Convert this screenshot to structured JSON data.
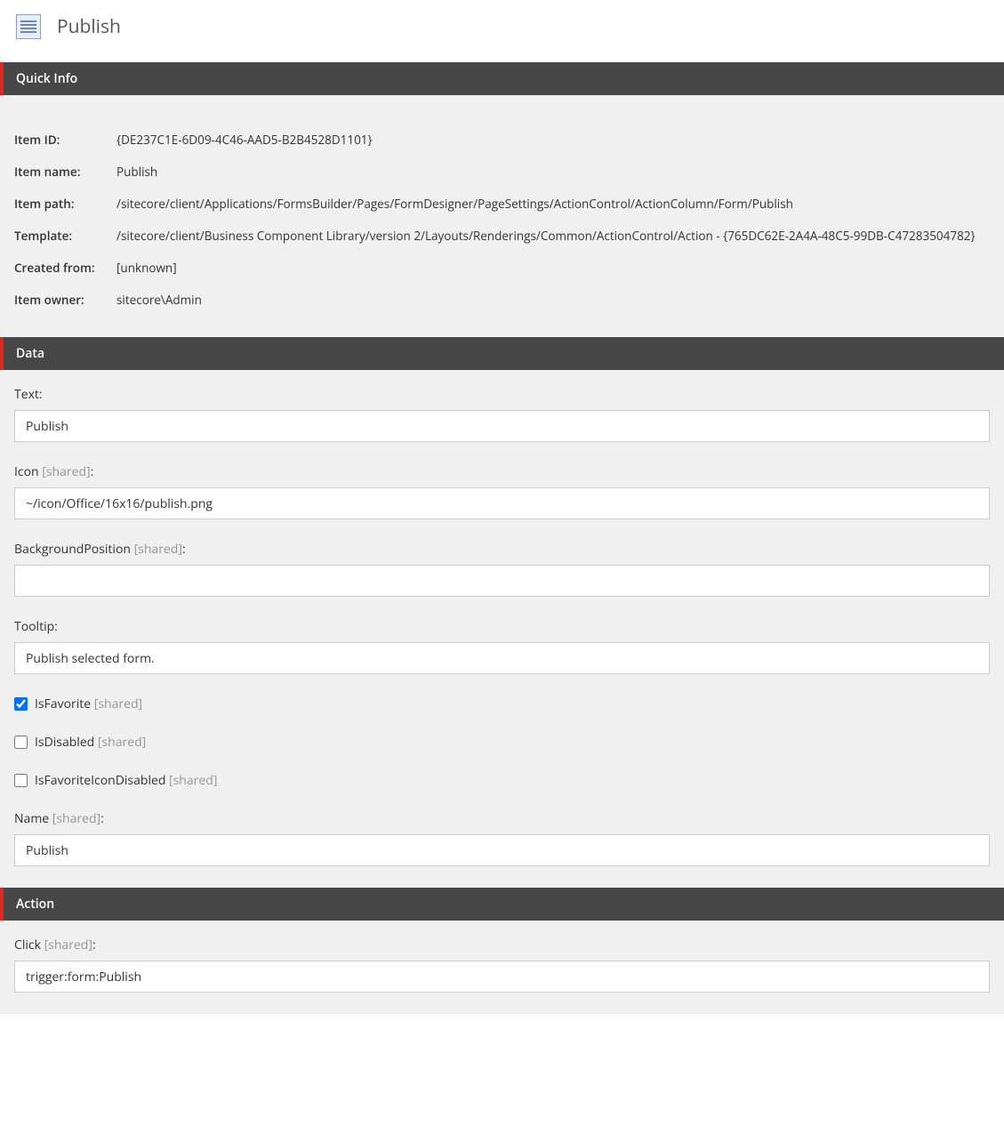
{
  "header": {
    "title": "Publish"
  },
  "sections": {
    "quick_info": {
      "title": "Quick Info",
      "rows": {
        "item_id": {
          "label": "Item ID:",
          "value": "{DE237C1E-6D09-4C46-AAD5-B2B4528D1101}"
        },
        "item_name": {
          "label": "Item name:",
          "value": "Publish"
        },
        "item_path": {
          "label": "Item path:",
          "value": "/sitecore/client/Applications/FormsBuilder/Pages/FormDesigner/PageSettings/ActionControl/ActionColumn/Form/Publish"
        },
        "template": {
          "label": "Template:",
          "value": "/sitecore/client/Business Component Library/version 2/Layouts/Renderings/Common/ActionControl/Action - {765DC62E-2A4A-48C5-99DB-C47283504782}"
        },
        "created_from": {
          "label": "Created from:",
          "value": "[unknown]"
        },
        "item_owner": {
          "label": "Item owner:",
          "value": "sitecore\\Admin"
        }
      }
    },
    "data": {
      "title": "Data",
      "fields": {
        "text": {
          "label": "Text:",
          "shared": "",
          "value": "Publish"
        },
        "icon": {
          "label": "Icon ",
          "shared": "[shared]",
          "suffix": ":",
          "value": "~/icon/Office/16x16/publish.png"
        },
        "bgpos": {
          "label": "BackgroundPosition ",
          "shared": "[shared]",
          "suffix": ":",
          "value": ""
        },
        "tooltip": {
          "label": "Tooltip:",
          "shared": "",
          "value": "Publish selected form."
        },
        "isfavorite": {
          "label": "IsFavorite ",
          "shared": "[shared]",
          "checked": true
        },
        "isdisabled": {
          "label": "IsDisabled ",
          "shared": "[shared]",
          "checked": false
        },
        "isfavicondisabled": {
          "label": "IsFavoriteIconDisabled ",
          "shared": "[shared]",
          "checked": false
        },
        "name": {
          "label": "Name ",
          "shared": "[shared]",
          "suffix": ":",
          "value": "Publish"
        }
      }
    },
    "action": {
      "title": "Action",
      "fields": {
        "click": {
          "label": "Click ",
          "shared": "[shared]",
          "suffix": ":",
          "value": "trigger:form:Publish"
        }
      }
    }
  }
}
